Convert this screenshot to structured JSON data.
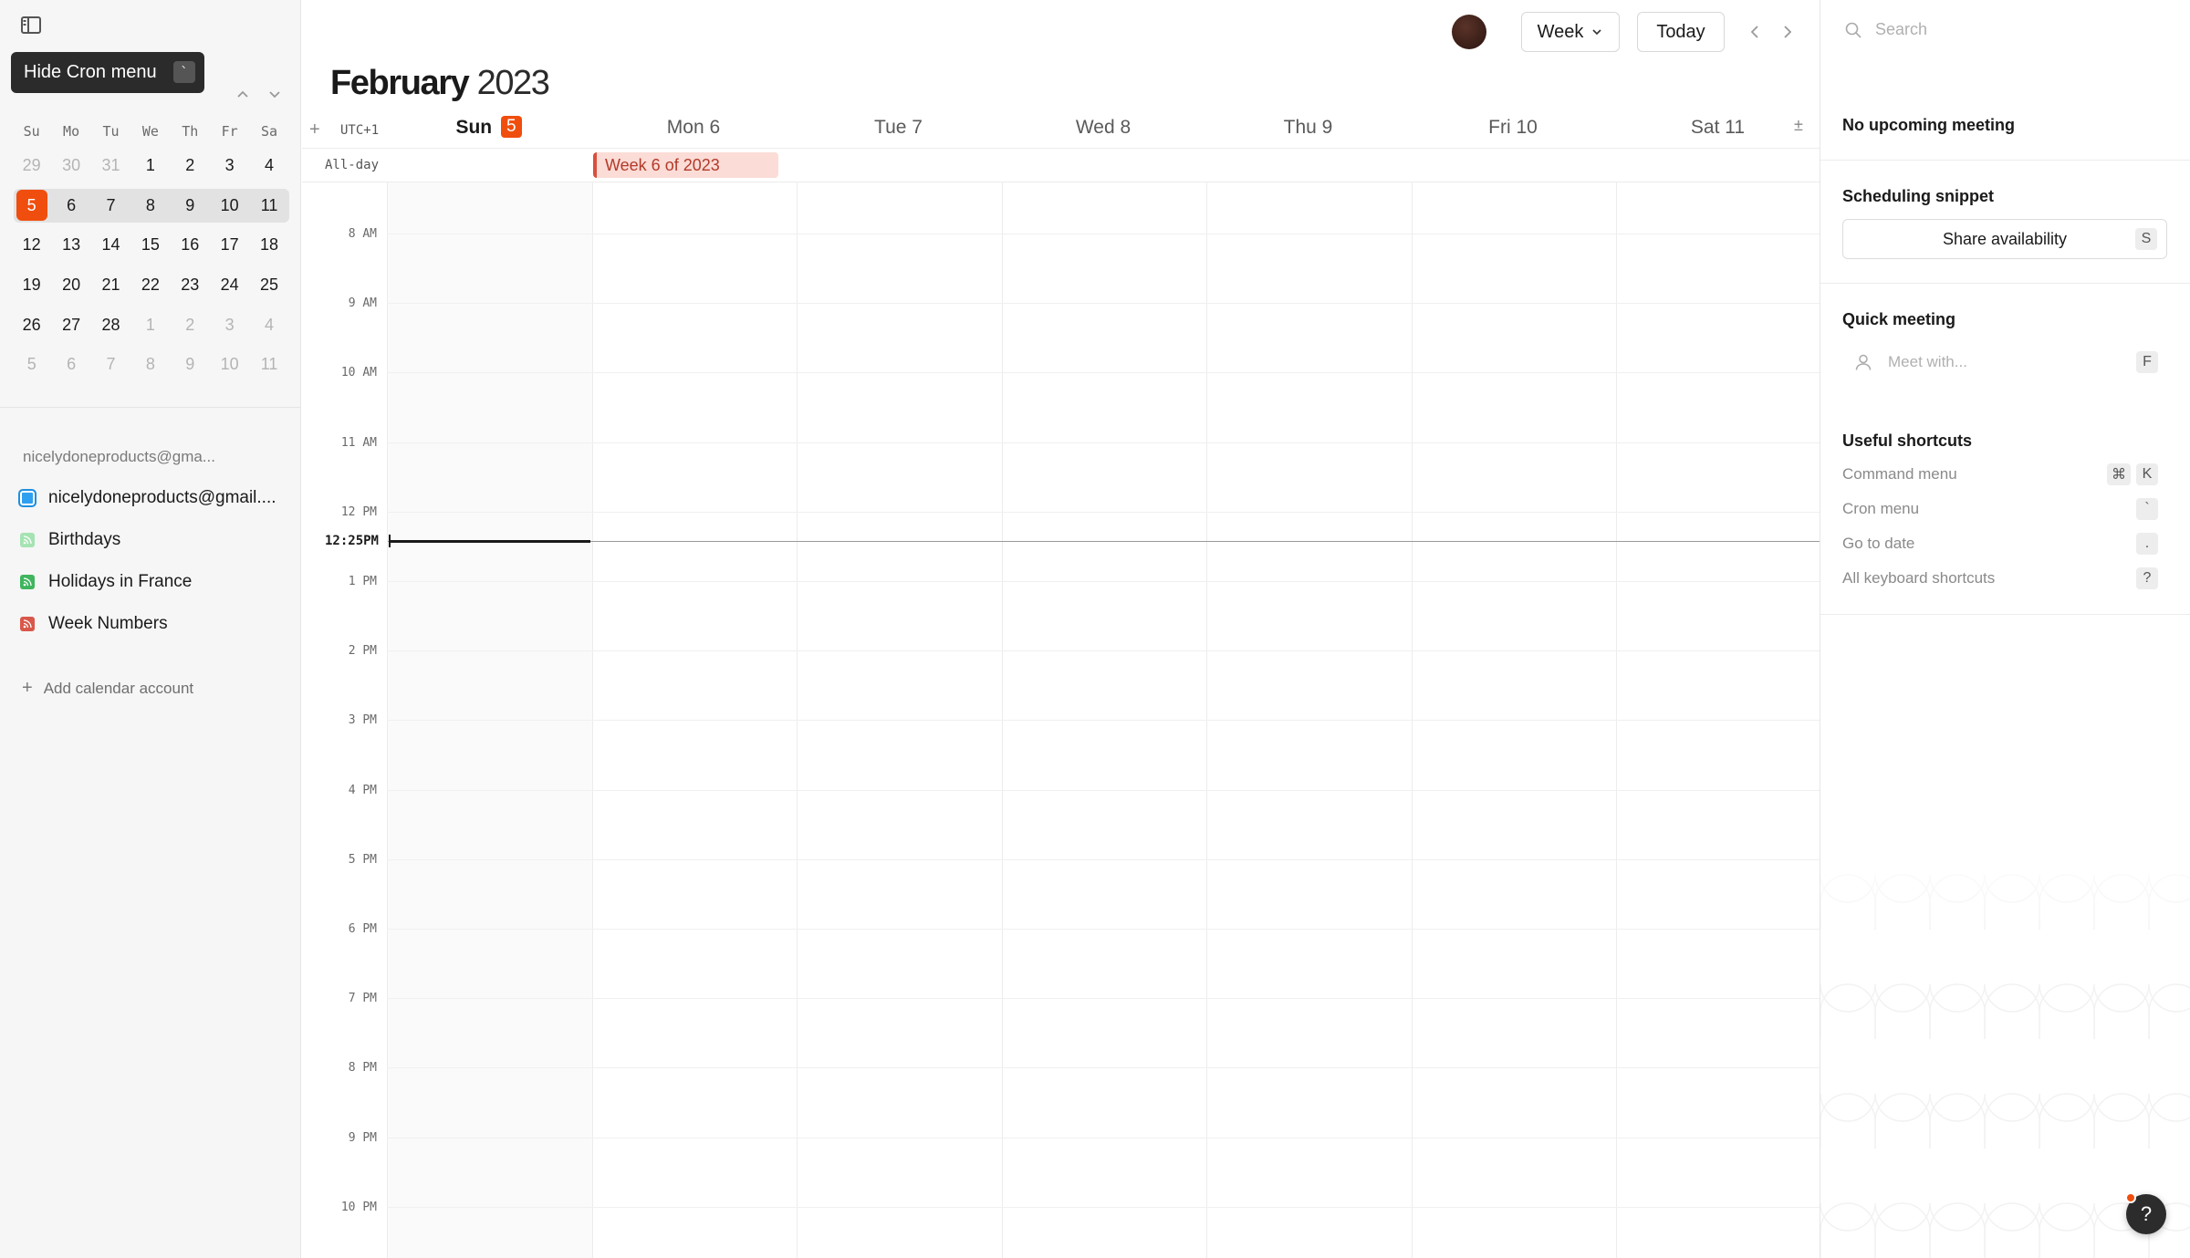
{
  "sidebar": {
    "toggle_icon": "sidebar-icon",
    "tooltip": {
      "label": "Hide Cron menu",
      "shortcut": "`"
    },
    "mini_calendar": {
      "weekdays": [
        "Su",
        "Mo",
        "Tu",
        "We",
        "Th",
        "Fr",
        "Sa"
      ],
      "weeks": [
        [
          "29",
          "30",
          "31",
          "1",
          "2",
          "3",
          "4"
        ],
        [
          "5",
          "6",
          "7",
          "8",
          "9",
          "10",
          "11"
        ],
        [
          "12",
          "13",
          "14",
          "15",
          "16",
          "17",
          "18"
        ],
        [
          "19",
          "20",
          "21",
          "22",
          "23",
          "24",
          "25"
        ],
        [
          "26",
          "27",
          "28",
          "1",
          "2",
          "3",
          "4"
        ],
        [
          "5",
          "6",
          "7",
          "8",
          "9",
          "10",
          "11"
        ]
      ],
      "today": "5"
    },
    "account_label": "nicelydoneproducts@gma...",
    "calendars": [
      {
        "label": "nicelydoneproducts@gmail....",
        "color": "#2fa0f0",
        "type": "main"
      },
      {
        "label": "Birthdays",
        "color": "#7cd48f",
        "type": "feed"
      },
      {
        "label": "Holidays in France",
        "color": "#3fb55e",
        "type": "feed"
      },
      {
        "label": "Week Numbers",
        "color": "#d9574a",
        "type": "feed"
      }
    ],
    "add_account": "Add calendar account"
  },
  "toolbar": {
    "view_label": "Week",
    "today_label": "Today"
  },
  "header": {
    "month": "February",
    "year": "2023",
    "timezone": "UTC+1",
    "add_symbol": "+",
    "expand_symbol": "±"
  },
  "week": {
    "days": [
      {
        "name": "Sun",
        "num": "5",
        "today": true
      },
      {
        "name": "Mon",
        "num": "6"
      },
      {
        "name": "Tue",
        "num": "7"
      },
      {
        "name": "Wed",
        "num": "8"
      },
      {
        "name": "Thu",
        "num": "9"
      },
      {
        "name": "Fri",
        "num": "10"
      },
      {
        "name": "Sat",
        "num": "11"
      }
    ],
    "allday_label": "All-day",
    "allday_event": "Week 6 of 2023",
    "hours": [
      "8 AM",
      "9 AM",
      "10 AM",
      "11 AM",
      "12 PM",
      "1 PM",
      "2 PM",
      "3 PM",
      "4 PM",
      "5 PM",
      "6 PM",
      "7 PM",
      "8 PM",
      "9 PM",
      "10 PM"
    ],
    "now_label": "12:25PM"
  },
  "right_panel": {
    "search_placeholder": "Search",
    "no_meeting": "No upcoming meeting",
    "scheduling_title": "Scheduling snippet",
    "share_label": "Share availability",
    "share_key": "S",
    "quick_title": "Quick meeting",
    "meet_placeholder": "Meet with...",
    "meet_key": "F",
    "shortcuts_title": "Useful shortcuts",
    "shortcuts": [
      {
        "label": "Command menu",
        "keys": [
          "⌘",
          "K"
        ]
      },
      {
        "label": "Cron menu",
        "keys": [
          "`"
        ]
      },
      {
        "label": "Go to date",
        "keys": [
          "."
        ]
      },
      {
        "label": "All keyboard shortcuts",
        "keys": [
          "?"
        ]
      }
    ]
  },
  "help": {
    "label": "?"
  },
  "colors": {
    "accent": "#f04e0e",
    "event_bg": "#fbdcd6",
    "event_border": "#d94f3c"
  }
}
